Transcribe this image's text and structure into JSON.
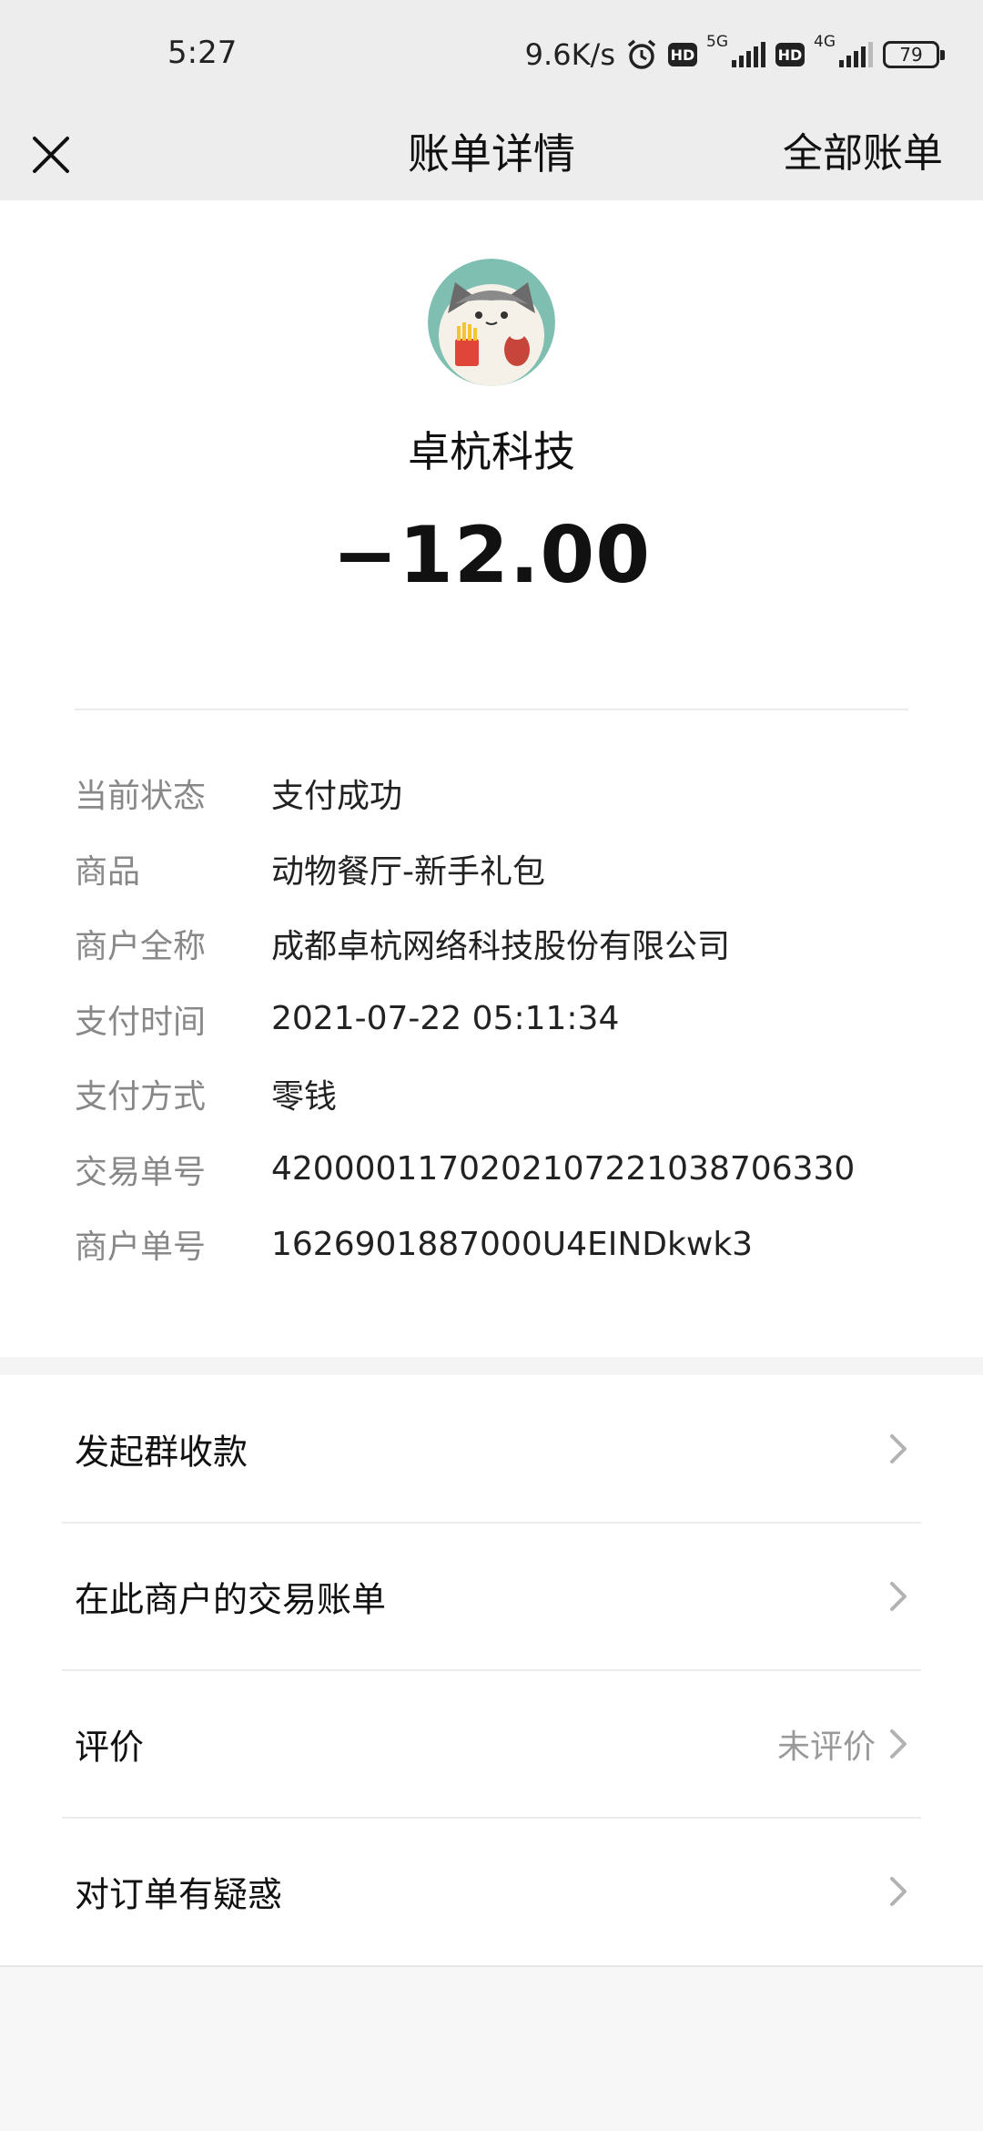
{
  "status_bar": {
    "time": "5:27",
    "speed": "9.6K/s",
    "hd1": "HD",
    "net1": "5G",
    "hd2": "HD",
    "net2": "4G",
    "battery": "79",
    "alarm_icon": "alarm-icon",
    "signal_icon": "signal-bars-icon"
  },
  "nav": {
    "close_icon": "close-icon",
    "title": "账单详情",
    "right_link": "全部账单"
  },
  "bill": {
    "merchant": "卓杭科技",
    "amount": "−12.00",
    "details": [
      {
        "label": "当前状态",
        "value": "支付成功"
      },
      {
        "label": "商品",
        "value": "动物餐厅-新手礼包"
      },
      {
        "label": "商户全称",
        "value": "成都卓杭网络科技股份有限公司"
      },
      {
        "label": "支付时间",
        "value": "2021-07-22 05:11:34"
      },
      {
        "label": "支付方式",
        "value": "零钱"
      },
      {
        "label": "交易单号",
        "value": "4200001170202107221038706330"
      },
      {
        "label": "商户单号",
        "value": "1626901887000U4EINDkwk3"
      }
    ]
  },
  "actions": [
    {
      "label": "发起群收款",
      "sub": ""
    },
    {
      "label": "在此商户的交易账单",
      "sub": ""
    },
    {
      "label": "评价",
      "sub": "未评价"
    },
    {
      "label": "对订单有疑惑",
      "sub": ""
    }
  ],
  "colors": {
    "header_bg": "#ededed",
    "label_gray": "#888888",
    "text": "#111111"
  }
}
